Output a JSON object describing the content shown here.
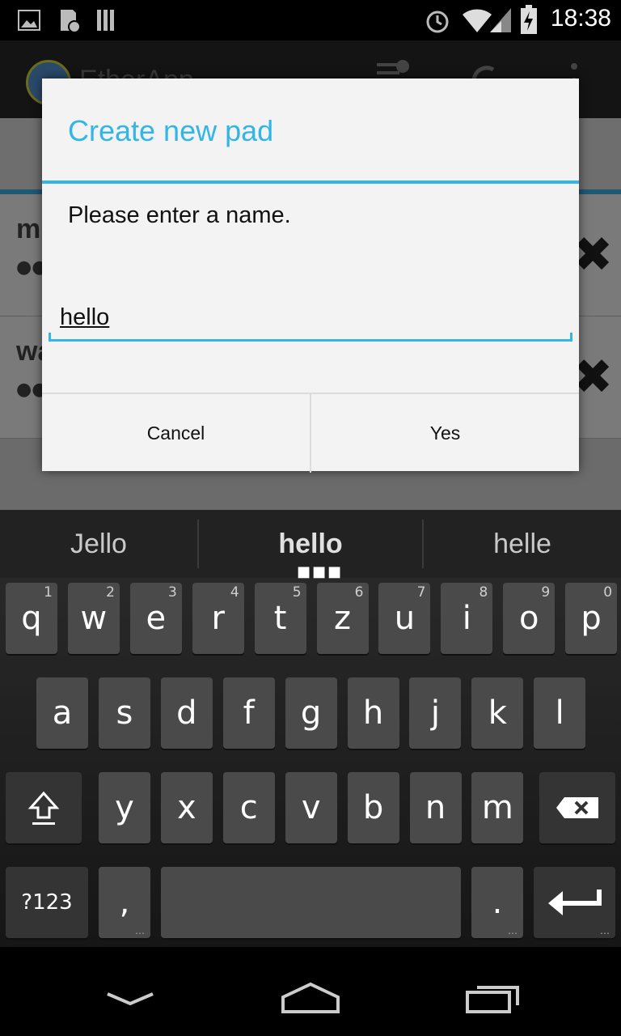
{
  "status_bar": {
    "time": "18:38"
  },
  "app": {
    "title": "EtherApp",
    "rows": [
      {
        "name": "m"
      },
      {
        "name": "wa"
      }
    ]
  },
  "dialog": {
    "title": "Create new pad",
    "message": "Please enter a name.",
    "input_value": "hello",
    "cancel_label": "Cancel",
    "confirm_label": "Yes"
  },
  "keyboard": {
    "suggestions": [
      "Jello",
      "hello",
      "helle"
    ],
    "row1": [
      {
        "k": "q",
        "h": "1"
      },
      {
        "k": "w",
        "h": "2"
      },
      {
        "k": "e",
        "h": "3"
      },
      {
        "k": "r",
        "h": "4"
      },
      {
        "k": "t",
        "h": "5"
      },
      {
        "k": "z",
        "h": "6"
      },
      {
        "k": "u",
        "h": "7"
      },
      {
        "k": "i",
        "h": "8"
      },
      {
        "k": "o",
        "h": "9"
      },
      {
        "k": "p",
        "h": "0"
      }
    ],
    "row2": [
      "a",
      "s",
      "d",
      "f",
      "g",
      "h",
      "j",
      "k",
      "l"
    ],
    "row3": [
      "y",
      "x",
      "c",
      "v",
      "b",
      "n",
      "m"
    ],
    "symbols_label": "?123",
    "comma": ",",
    "period": "."
  },
  "colors": {
    "accent": "#33b5e5"
  }
}
